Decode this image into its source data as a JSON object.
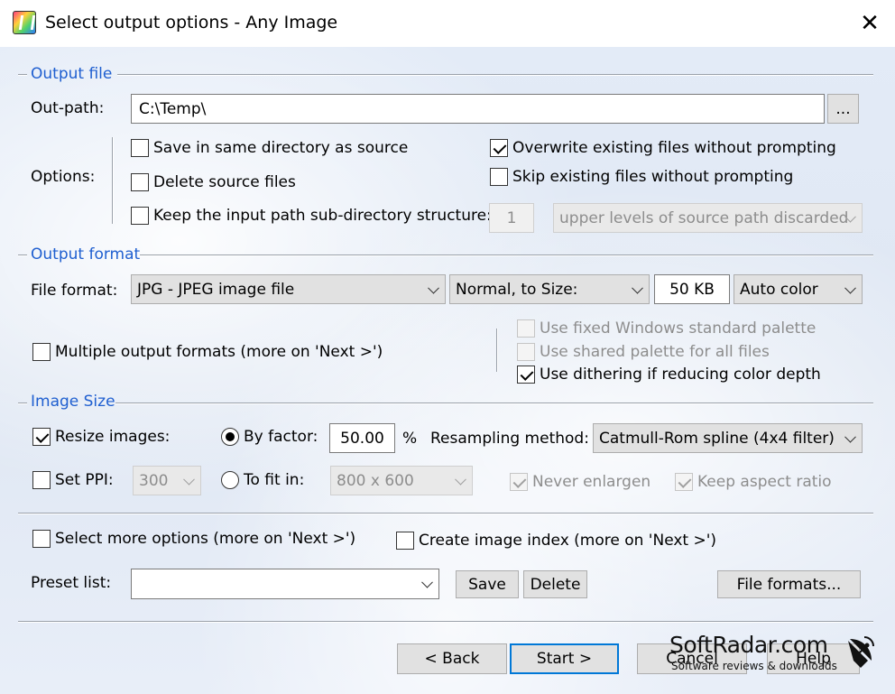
{
  "window": {
    "title": "Select output options - Any Image",
    "close_glyph": "✕"
  },
  "output_file": {
    "section_title": "Output file",
    "out_path_label": "Out-path:",
    "out_path_value": "C:\\Temp\\",
    "browse_label": "...",
    "options_label": "Options:",
    "save_same_dir": {
      "label": "Save in same directory as source",
      "checked": false
    },
    "delete_source": {
      "label": "Delete source files",
      "checked": false
    },
    "keep_subdir": {
      "label": "Keep the input path sub-directory structure:",
      "checked": false
    },
    "overwrite": {
      "label": "Overwrite existing files without prompting",
      "checked": true
    },
    "skip_existing": {
      "label": "Skip existing files without prompting",
      "checked": false
    },
    "levels_value": "1",
    "levels_select": "upper levels of source path discarded"
  },
  "output_format": {
    "section_title": "Output format",
    "file_format_label": "File format:",
    "file_format_value": "JPG - JPEG image file",
    "quality_mode": "Normal, to Size:",
    "size_value": "50 KB",
    "color_mode": "Auto color",
    "multiple_formats": {
      "label": "Multiple output formats (more on 'Next >')",
      "checked": false
    },
    "fixed_palette": {
      "label": "Use fixed Windows standard palette",
      "checked": false
    },
    "shared_palette": {
      "label": "Use shared palette for all files",
      "checked": false
    },
    "dithering": {
      "label": "Use dithering if reducing color depth",
      "checked": true
    }
  },
  "image_size": {
    "section_title": "Image Size",
    "resize": {
      "label": "Resize images:",
      "checked": true
    },
    "by_factor": {
      "label": "By factor:",
      "selected": true
    },
    "factor_value": "50.00",
    "percent": "%",
    "resampling_label": "Resampling method:",
    "resampling_value": "Catmull-Rom spline (4x4 filter)",
    "set_ppi": {
      "label": "Set PPI:",
      "checked": false
    },
    "ppi_value": "300",
    "to_fit": {
      "label": "To fit in:",
      "selected": false
    },
    "fit_value": "800 x 600",
    "never_enlarge": {
      "label": "Never enlargen",
      "checked": true
    },
    "keep_aspect": {
      "label": "Keep aspect ratio",
      "checked": true
    }
  },
  "more": {
    "select_more": {
      "label": "Select more options (more on 'Next >')",
      "checked": false
    },
    "create_index": {
      "label": "Create image index (more on 'Next >')",
      "checked": false
    },
    "preset_label": "Preset list:",
    "preset_value": "",
    "save_label": "Save",
    "delete_label": "Delete",
    "file_formats_label": "File formats..."
  },
  "footer": {
    "back_label": "< Back",
    "start_label": "Start >",
    "cancel_label": "Cancel",
    "help_label": "Help"
  },
  "watermark": {
    "title": "SoftRadar.com",
    "subtitle": "Software reviews & downloads"
  },
  "colors": {
    "section_title": "#1f5fd0",
    "default_button_border": "#0078d7"
  }
}
